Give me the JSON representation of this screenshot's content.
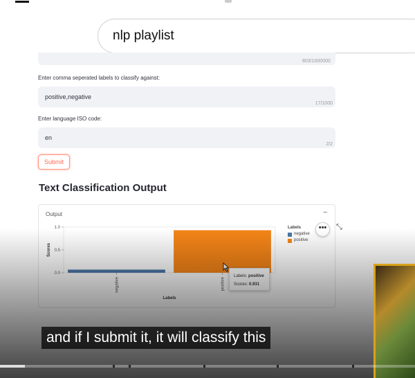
{
  "search": {
    "value": "nlp playlist"
  },
  "form": {
    "top_counter": "803/1000000",
    "labels_prompt": "Enter comma seperated labels to classify against:",
    "labels_value": "positive,negative",
    "labels_count": "17/1000",
    "lang_prompt": "Enter language ISO code:",
    "lang_value": "en",
    "lang_count": "2/2",
    "submit_label": "Submit"
  },
  "output": {
    "heading": "Text Classification Output",
    "card_label": "Output",
    "collapse_glyph": "–",
    "more_glyph": "•••",
    "expand_glyph": "⤡"
  },
  "chart_data": {
    "type": "bar",
    "categories": [
      "negative",
      "positive"
    ],
    "values": [
      0.069,
      0.931
    ],
    "xlabel": "Labels",
    "ylabel": "Scores",
    "ylim": [
      0,
      1.0
    ],
    "yticks": [
      "0.0",
      "0.5",
      "1.0"
    ],
    "colors": [
      "#4c78a8",
      "#f58518"
    ],
    "legend": {
      "title": "Labels",
      "entries": [
        "negative",
        "positive"
      ],
      "placement": "right"
    },
    "tooltip": {
      "labels_key": "Labels:",
      "labels_value": "positive",
      "scores_key": "Scores:",
      "scores_value": "0.931"
    }
  },
  "video": {
    "caption": "and if I submit it, it will classify this",
    "progress": 0.06
  }
}
